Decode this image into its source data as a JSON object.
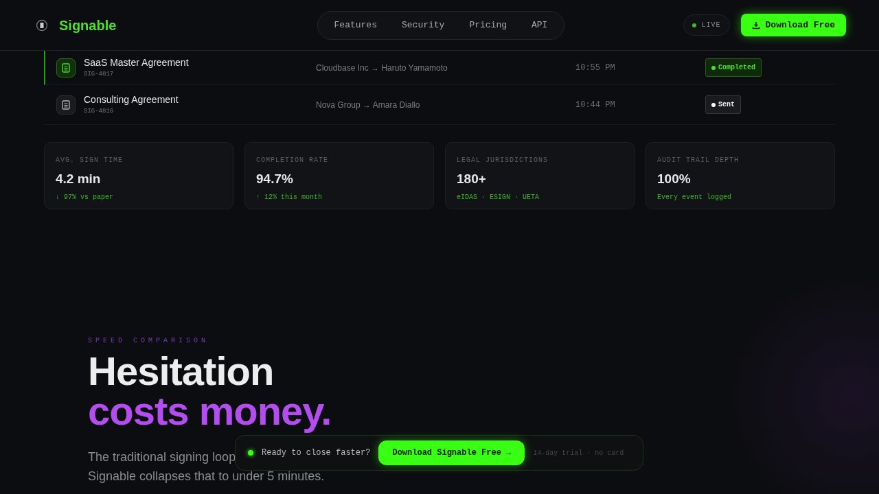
{
  "brand": {
    "name": "Signable"
  },
  "nav": [
    {
      "label": "Features"
    },
    {
      "label": "Security"
    },
    {
      "label": "Pricing"
    },
    {
      "label": "API"
    }
  ],
  "live": {
    "label": "LIVE"
  },
  "download_button": {
    "label": "Download Free"
  },
  "documents": [
    {
      "title": "SaaS Master Agreement",
      "id": "SIG-4817",
      "parties": "Cloudbase Inc → Haruto Yamamoto",
      "time": "10:55 PM",
      "status": {
        "label": "Completed",
        "kind": "completed"
      },
      "selected": true
    },
    {
      "title": "Consulting Agreement",
      "id": "SIG-4816",
      "parties": "Nova Group → Amara Diallo",
      "time": "10:44 PM",
      "status": {
        "label": "Sent",
        "kind": "sent"
      },
      "selected": false
    }
  ],
  "stats": [
    {
      "label": "AVG. SIGN TIME",
      "value": "4.2 min",
      "note": "↓ 97% vs paper"
    },
    {
      "label": "COMPLETION RATE",
      "value": "94.7%",
      "note": "↑ 12% this month"
    },
    {
      "label": "LEGAL JURISDICTIONS",
      "value": "180+",
      "note": "eIDAS · ESIGN · UETA"
    },
    {
      "label": "AUDIT TRAIL DEPTH",
      "value": "100%",
      "note": "Every event logged"
    }
  ],
  "section": {
    "eyebrow": "SPEED COMPARISON",
    "heading_line_1": "Hesitation",
    "heading_line_2": "costs money.",
    "body_lines": [
      "The traditional signing loop",
      "Signable collapses that to under 5 minutes."
    ]
  },
  "floating_bar": {
    "prompt": "Ready to close faster?",
    "button": "Download Signable Free",
    "arrow": "→",
    "note": "14-day trial · no card"
  }
}
